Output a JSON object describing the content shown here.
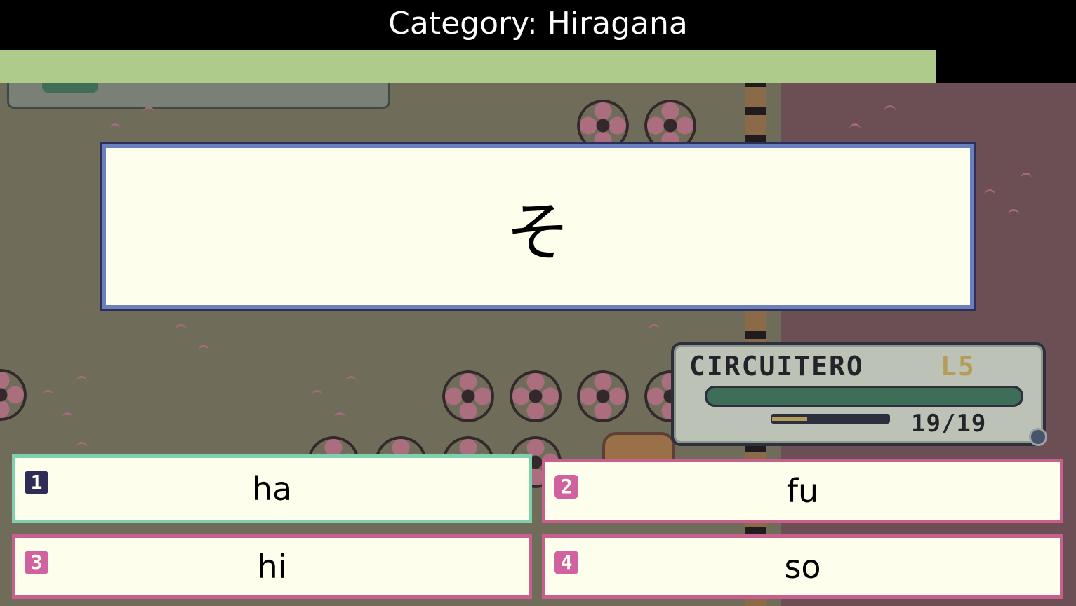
{
  "header": {
    "category_title": "Category: Hiragana",
    "timer_fraction": 0.87
  },
  "question": {
    "character": "そ"
  },
  "player": {
    "name": "CIRCUITERO",
    "level": "L5",
    "hp_text": "19/19",
    "hp_fraction": 1.0,
    "xp_fraction": 0.3
  },
  "answers": [
    {
      "key": "1",
      "label": "ha",
      "selected": true
    },
    {
      "key": "2",
      "label": "fu",
      "selected": false
    },
    {
      "key": "3",
      "label": "hi",
      "selected": false
    },
    {
      "key": "4",
      "label": "so",
      "selected": false
    }
  ],
  "colors": {
    "timer_fill": "#aecb8b",
    "selected_border": "#7fd0ad",
    "answer_border": "#c95f8d",
    "card_background": "#fefeec"
  }
}
